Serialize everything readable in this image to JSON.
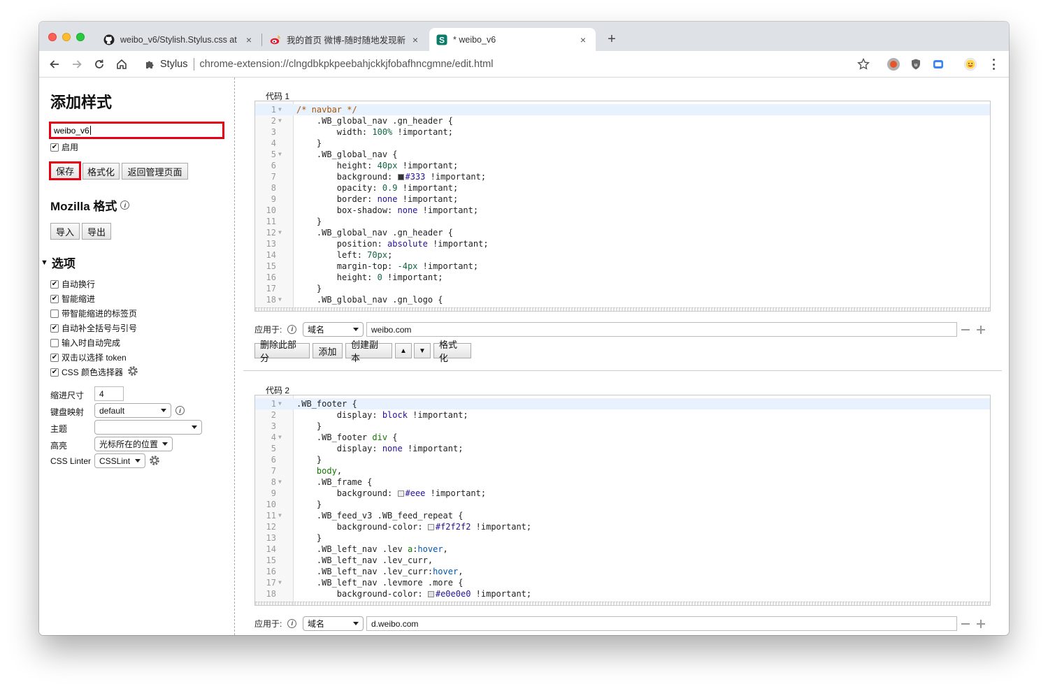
{
  "browser": {
    "tabs": [
      {
        "title": "weibo_v6/Stylish.Stylus.css at",
        "icon": "github-icon"
      },
      {
        "title": "我的首页 微博-随时随地发现新鲜",
        "icon": "weibo-icon"
      },
      {
        "title": "* weibo_v6",
        "icon": "stylus-icon"
      }
    ],
    "new_tab": "+",
    "close_glyph": "×",
    "extension_name": "Stylus",
    "url": "chrome-extension://clngdbkpkpeebahjckkjfobafhncgmne/edit.html"
  },
  "sidebar": {
    "title": "添加样式",
    "style_name": "weibo_v6",
    "enabled_label": "启用",
    "save_label": "保存",
    "format_label": "格式化",
    "back_label": "返回管理页面",
    "mozilla_heading": "Mozilla 格式",
    "import_label": "导入",
    "export_label": "导出",
    "options_heading": "选项",
    "options": [
      {
        "label": "自动换行",
        "checked": true
      },
      {
        "label": "智能缩进",
        "checked": true
      },
      {
        "label": "带智能缩进的标签页",
        "checked": false
      },
      {
        "label": "自动补全括号与引号",
        "checked": true
      },
      {
        "label": "输入时自动完成",
        "checked": false
      },
      {
        "label": "双击以选择 token",
        "checked": true
      },
      {
        "label": "CSS 颜色选择器",
        "checked": true
      }
    ],
    "indent_label": "缩进尺寸",
    "indent_value": "4",
    "keymap_label": "键盘映射",
    "keymap_value": "default",
    "theme_label": "主题",
    "theme_value": "",
    "highlight_label": "高亮",
    "highlight_value": "光标所在的位置",
    "linter_label": "CSS Linter",
    "linter_value": "CSSLint"
  },
  "sections": [
    {
      "label": "代码 1",
      "apply_label": "应用于:",
      "apply_type": "域名",
      "apply_value": "weibo.com",
      "buttons": {
        "delete": "删除此部分",
        "add": "添加",
        "clone": "创建副本",
        "up": "▲",
        "down": "▼",
        "format": "格式化"
      }
    },
    {
      "label": "代码 2",
      "apply_label": "应用于:",
      "apply_type": "域名",
      "apply_value": "d.weibo.com"
    }
  ],
  "colors": {
    "highlight_red": "#e60012",
    "swatch_333": "#333333",
    "swatch_eee": "#eeeeee",
    "swatch_f2": "#f2f2f2",
    "swatch_e0": "#e0e0e0"
  }
}
